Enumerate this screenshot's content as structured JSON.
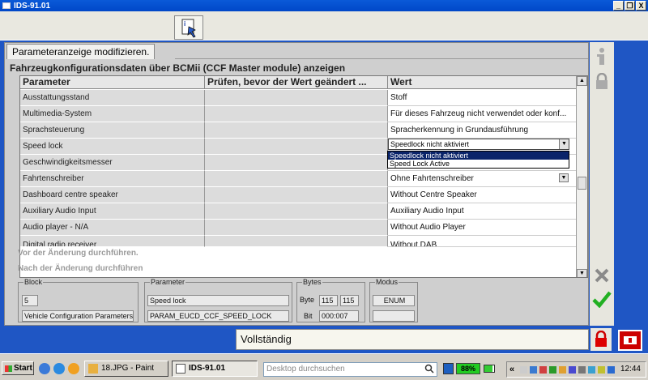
{
  "window": {
    "title": "IDS-91.01",
    "min_label": "_",
    "restore_label": "❐",
    "close_label": "X"
  },
  "toolbar": {
    "icon": "document-settings-icon"
  },
  "tab": {
    "label": "Parameteranzeige modifizieren."
  },
  "panel": {
    "title": "Fahrzeugkonfigurationsdaten über BCMii (CCF Master module) anzeigen"
  },
  "table": {
    "headers": [
      "Parameter",
      "Prüfen, bevor der Wert geändert ...",
      "Wert"
    ],
    "rows": [
      {
        "param": "Ausstattungsstand",
        "check": "",
        "value": "Stoff"
      },
      {
        "param": "Multimedia-System",
        "check": "",
        "value": "Für dieses Fahrzeug nicht verwendet oder konf..."
      },
      {
        "param": "Sprachsteuerung",
        "check": "",
        "value": "Spracherkennung in Grundausführung"
      },
      {
        "param": "Speed lock",
        "check": "",
        "value": ""
      },
      {
        "param": "Geschwindigkeitsmesser",
        "check": "",
        "value": ""
      },
      {
        "param": "Fahrtenschreiber",
        "check": "",
        "value": "Ohne Fahrtenschreiber"
      },
      {
        "param": "Dashboard centre speaker",
        "check": "",
        "value": "Without Centre Speaker"
      },
      {
        "param": "Auxiliary Audio Input",
        "check": "",
        "value": "Auxiliary Audio Input"
      },
      {
        "param": "Audio player - N/A",
        "check": "",
        "value": "Without Audio Player"
      },
      {
        "param": "Digital radio receiver",
        "check": "",
        "value": "Without DAB"
      }
    ]
  },
  "dropdown": {
    "selected": "Speedlock nicht aktiviert",
    "options": [
      "Speedlock nicht aktiviert",
      "Speed Lock Active"
    ]
  },
  "actions": {
    "before_change": "Vor der Änderung durchführen.",
    "after_change": "Nach der Änderung durchführen"
  },
  "block": {
    "legend": "Block",
    "number": "5",
    "name": "Vehicle Configuration Parameters"
  },
  "parameter": {
    "legend": "Parameter",
    "name": "Speed lock",
    "id": "PARAM_EUCD_CCF_SPEED_LOCK"
  },
  "bytes": {
    "legend": "Bytes",
    "byte_label": "Byte",
    "byte1": "115",
    "byte2": "115",
    "bit_label": "Bit",
    "bit": "000:007"
  },
  "modus": {
    "legend": "Modus",
    "value": "ENUM",
    "extra": ""
  },
  "status": {
    "text": "Vollständig"
  },
  "taskbar": {
    "start": "Start",
    "items": [
      "18.JPG - Paint",
      "IDS-91.01"
    ],
    "search_placeholder": "Desktop durchsuchen",
    "battery": "88%",
    "clock": "12:44",
    "tray_chevron": "«"
  }
}
